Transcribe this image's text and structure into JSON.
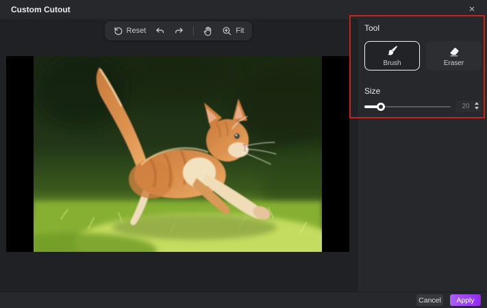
{
  "dialog": {
    "title": "Custom Cutout",
    "close_icon": "×"
  },
  "toolbar": {
    "reset_label": "Reset",
    "fit_label": "Fit",
    "icons": [
      "reset-icon",
      "undo-icon",
      "redo-icon",
      "hand-icon",
      "zoom-fit-icon"
    ]
  },
  "panel": {
    "tool_label": "Tool",
    "tools": [
      {
        "label": "Brush",
        "icon": "brush-icon",
        "selected": true
      },
      {
        "label": "Eraser",
        "icon": "eraser-icon",
        "selected": false
      }
    ],
    "size_label": "Size",
    "size_value": "20",
    "size_percent": 19
  },
  "footer": {
    "cancel_label": "Cancel",
    "apply_label": "Apply"
  },
  "canvas": {
    "content": "Photo of an orange tabby kitten leaping to the right over sunlit green grass against a dark green blurred background"
  },
  "colors": {
    "accent_purple": "#9b3df2",
    "annotation_red": "#c8231d",
    "selected_border": "#f2f3f4"
  }
}
